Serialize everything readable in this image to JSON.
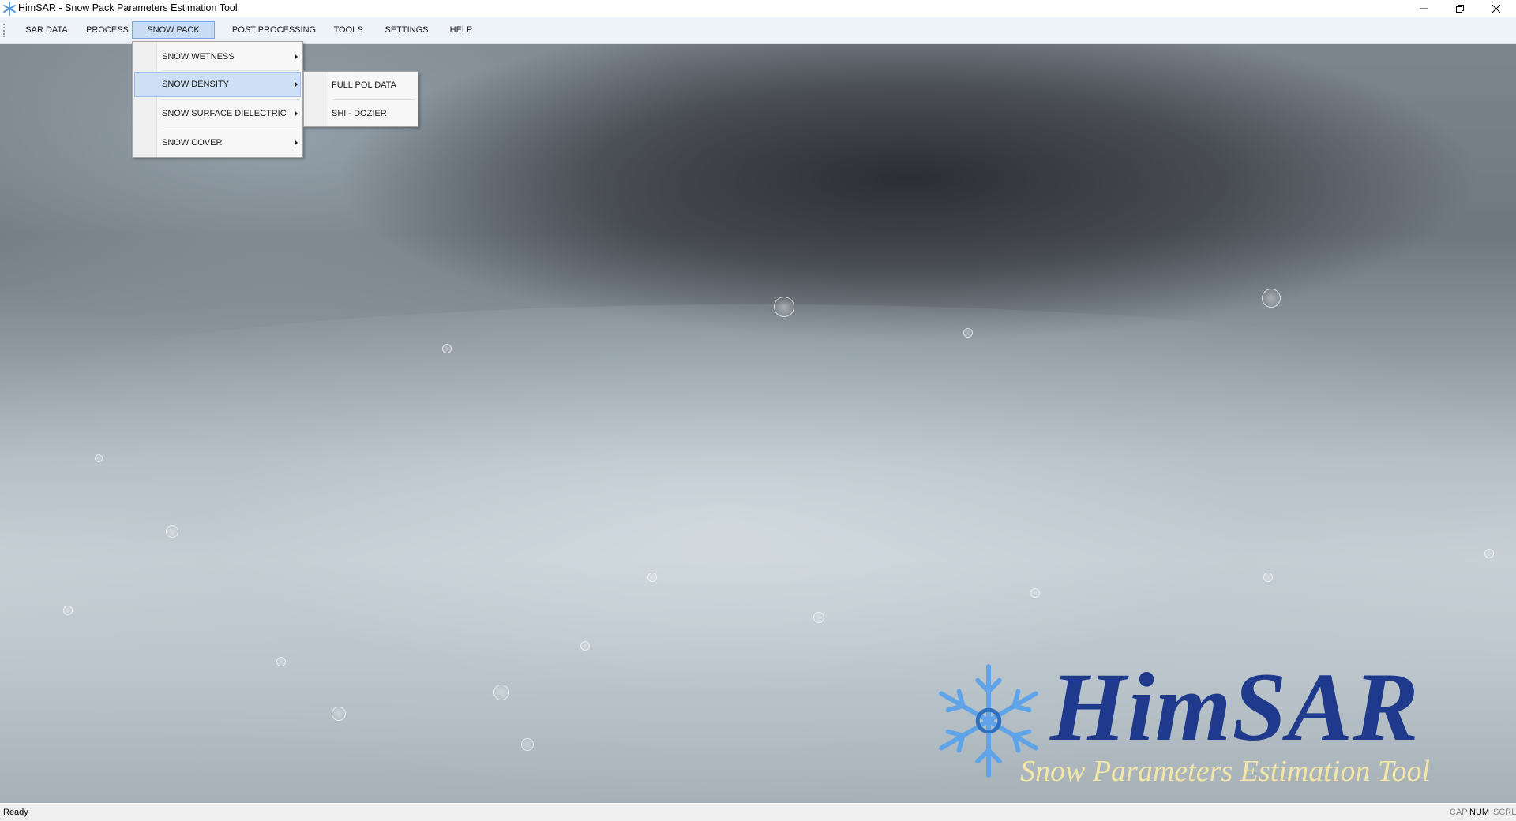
{
  "window": {
    "title": "HimSAR - Snow Pack Parameters Estimation Tool",
    "buttons": [
      "minimize",
      "restore",
      "close"
    ]
  },
  "menubar": {
    "items": [
      {
        "label": "SAR DATA"
      },
      {
        "label": "PROCESS"
      },
      {
        "label": "SNOW PACK",
        "active": true
      },
      {
        "label": "POST PROCESSING"
      },
      {
        "label": "TOOLS"
      },
      {
        "label": "SETTINGS"
      },
      {
        "label": "HELP"
      }
    ]
  },
  "snow_pack_menu": {
    "items": [
      {
        "label": "SNOW WETNESS",
        "has_submenu": true
      },
      {
        "label": "SNOW DENSITY",
        "has_submenu": true,
        "highlighted": true
      },
      {
        "label": "SNOW SURFACE DIELECTRIC",
        "has_submenu": true
      },
      {
        "label": "SNOW COVER",
        "has_submenu": true
      }
    ]
  },
  "snow_density_submenu": {
    "items": [
      {
        "label": "FULL POL DATA"
      },
      {
        "label": "SHI - DOZIER"
      }
    ]
  },
  "logo": {
    "title": "HimSAR",
    "subtitle": "Snow Parameters Estimation Tool",
    "title_color": "#1f3a8c",
    "subtitle_color": "#f3e6a6"
  },
  "statusbar": {
    "status": "Ready",
    "indicators": [
      {
        "label": "CAP",
        "on": false
      },
      {
        "label": "NUM",
        "on": true
      },
      {
        "label": "SCRL",
        "on": false
      }
    ]
  },
  "icons": {
    "app": "snowflake-icon",
    "minimize": "minimize-icon",
    "restore": "restore-icon",
    "close": "close-icon",
    "submenu_arrow": "chevron-right-icon"
  }
}
